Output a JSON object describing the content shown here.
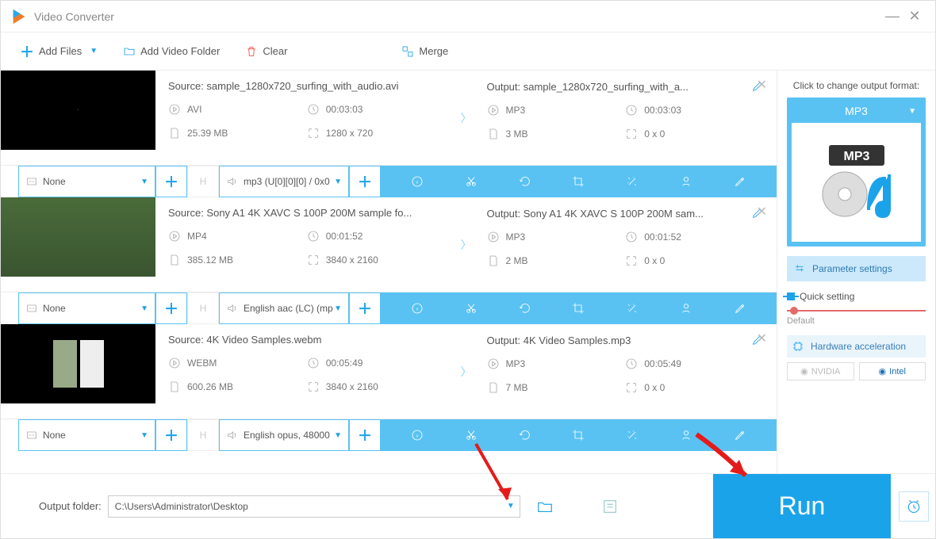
{
  "app": {
    "title": "Video Converter"
  },
  "toolbar": {
    "add_files": "Add Files",
    "add_folder": "Add Video Folder",
    "clear": "Clear",
    "merge": "Merge"
  },
  "files": [
    {
      "source_label": "Source: sample_1280x720_surfing_with_audio.avi",
      "output_label": "Output: sample_1280x720_surfing_with_a...",
      "src_format": "AVI",
      "src_duration": "00:03:03",
      "src_size": "25.39 MB",
      "src_res": "1280 x 720",
      "out_format": "MP3",
      "out_duration": "00:03:03",
      "out_size": "3 MB",
      "out_res": "0 x 0",
      "sub": "None",
      "audio": "mp3 (U[0][0][0] / 0x0"
    },
    {
      "source_label": "Source: Sony A1 4K XAVC S 100P 200M sample fo...",
      "output_label": "Output: Sony A1 4K XAVC S 100P 200M sam...",
      "src_format": "MP4",
      "src_duration": "00:01:52",
      "src_size": "385.12 MB",
      "src_res": "3840 x 2160",
      "out_format": "MP3",
      "out_duration": "00:01:52",
      "out_size": "2 MB",
      "out_res": "0 x 0",
      "sub": "None",
      "audio": "English aac (LC) (mp"
    },
    {
      "source_label": "Source: 4K Video Samples.webm",
      "output_label": "Output: 4K Video Samples.mp3",
      "src_format": "WEBM",
      "src_duration": "00:05:49",
      "src_size": "600.26 MB",
      "src_res": "3840 x 2160",
      "out_format": "MP3",
      "out_duration": "00:05:49",
      "out_size": "7 MB",
      "out_res": "0 x 0",
      "sub": "None",
      "audio": "English opus, 48000"
    }
  ],
  "right": {
    "title": "Click to change output format:",
    "format": "MP3",
    "param_settings": "Parameter settings",
    "quick_setting": "Quick setting",
    "slider_label": "Default",
    "hw_accel": "Hardware acceleration",
    "gpu_nvidia": "NVIDIA",
    "gpu_intel": "Intel"
  },
  "bottom": {
    "output_folder_label": "Output folder:",
    "output_path": "C:\\Users\\Administrator\\Desktop",
    "run": "Run"
  }
}
